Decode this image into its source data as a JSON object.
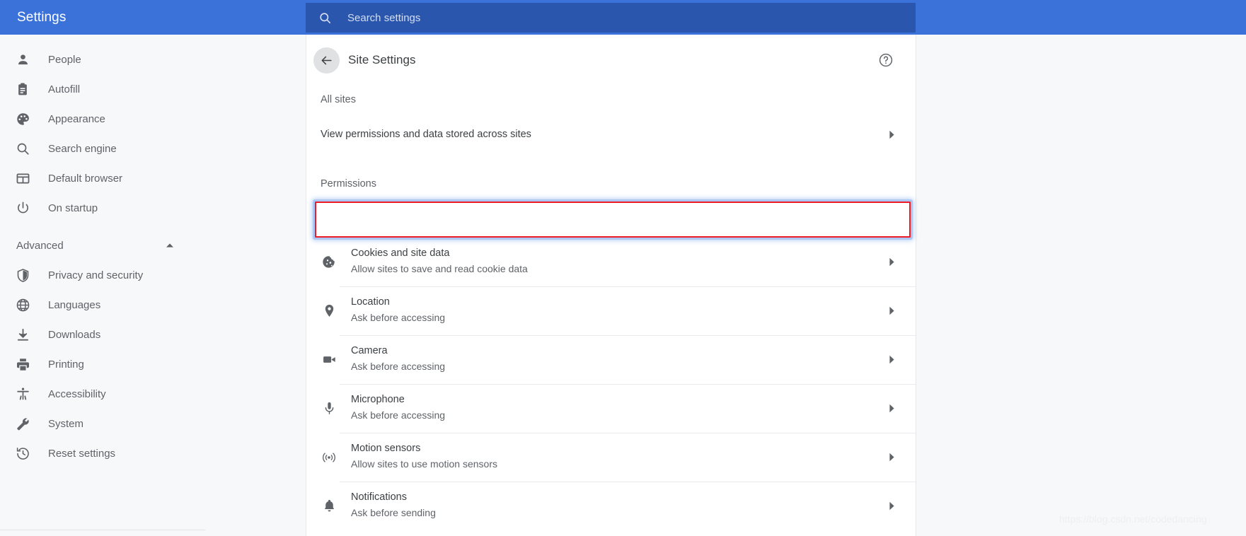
{
  "topbar": {
    "title": "Settings",
    "search": {
      "icon": "search-icon",
      "placeholder": "Search settings",
      "value": ""
    },
    "bg_color": "#3B72D9",
    "search_bg_color": "#2B56AE"
  },
  "sidebar": {
    "items": [
      {
        "label": "People",
        "icon": "person-icon"
      },
      {
        "label": "Autofill",
        "icon": "clipboard-icon"
      },
      {
        "label": "Appearance",
        "icon": "palette-icon"
      },
      {
        "label": "Search engine",
        "icon": "search-icon"
      },
      {
        "label": "Default browser",
        "icon": "browser-window-icon"
      },
      {
        "label": "On startup",
        "icon": "power-icon"
      }
    ],
    "advanced": {
      "label": "Advanced",
      "expanded": true,
      "caret_icon": "caret-up-icon"
    },
    "advanced_items": [
      {
        "label": "Privacy and security",
        "icon": "shield-icon"
      },
      {
        "label": "Languages",
        "icon": "globe-icon"
      },
      {
        "label": "Downloads",
        "icon": "download-icon"
      },
      {
        "label": "Printing",
        "icon": "printer-icon"
      },
      {
        "label": "Accessibility",
        "icon": "accessibility-icon"
      },
      {
        "label": "System",
        "icon": "wrench-icon"
      },
      {
        "label": "Reset settings",
        "icon": "history-restore-icon"
      }
    ]
  },
  "main": {
    "header": {
      "back_icon": "arrow-left-icon",
      "title": "Site Settings",
      "help_icon": "help-circle-icon"
    },
    "all_sites": {
      "section_label": "All sites",
      "row_label": "View permissions and data stored across sites",
      "chevron_icon": "chevron-right-icon"
    },
    "permissions": {
      "section_label": "Permissions",
      "rows": [
        {
          "title": "Cookies and site data",
          "subtitle": "Allow sites to save and read cookie data",
          "icon": "cookie-icon",
          "highlighted": true
        },
        {
          "title": "Location",
          "subtitle": "Ask before accessing",
          "icon": "location-pin-icon",
          "highlighted": false
        },
        {
          "title": "Camera",
          "subtitle": "Ask before accessing",
          "icon": "camera-icon",
          "highlighted": false
        },
        {
          "title": "Microphone",
          "subtitle": "Ask before accessing",
          "icon": "microphone-icon",
          "highlighted": false
        },
        {
          "title": "Motion sensors",
          "subtitle": "Allow sites to use motion sensors",
          "icon": "motion-sensor-icon",
          "highlighted": false
        },
        {
          "title": "Notifications",
          "subtitle": "Ask before sending",
          "icon": "bell-icon",
          "highlighted": false
        }
      ]
    },
    "highlight_colors": {
      "inner_border": "#EE1C25",
      "outer_glow": "#AEC6F4"
    }
  },
  "watermark": {
    "text": "https://blog.csdn.net/codedancing"
  }
}
